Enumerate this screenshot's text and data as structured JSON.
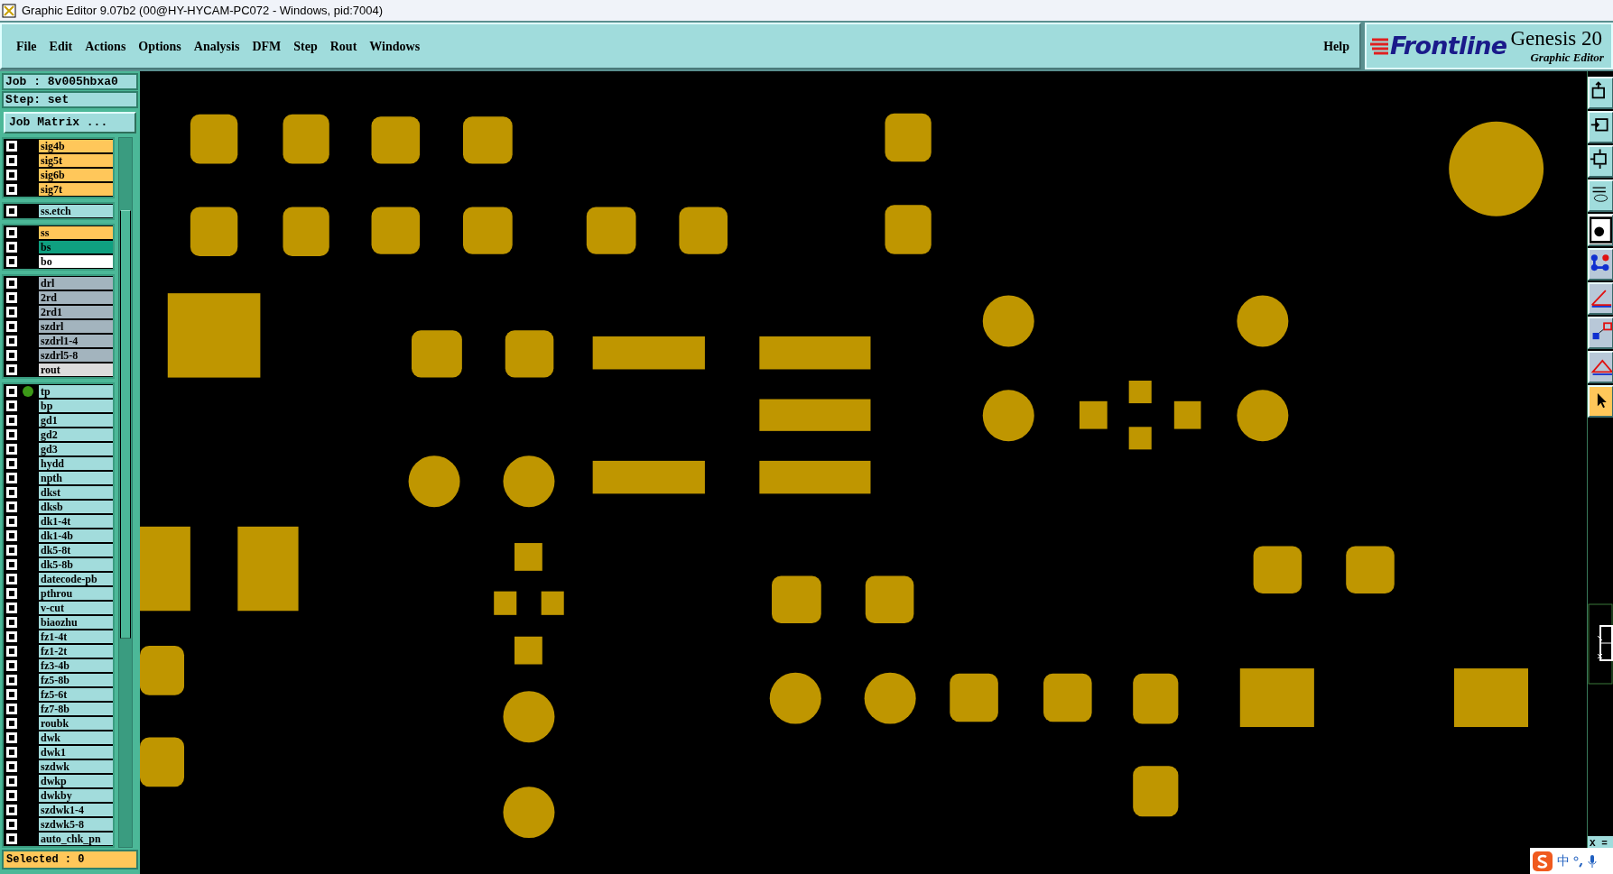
{
  "window": {
    "title": "Graphic Editor 9.07b2 (00@HY-HYCAM-PC072 - Windows, pid:7004)"
  },
  "menu": {
    "items": [
      "File",
      "Edit",
      "Actions",
      "Options",
      "Analysis",
      "DFM",
      "Step",
      "Rout",
      "Windows"
    ],
    "help": "Help"
  },
  "logo": {
    "brand": "Frontline",
    "product": "Genesis 20",
    "subtitle": "Graphic Editor"
  },
  "job": {
    "job_label": "Job : 8v005hbxa0",
    "step_label": "Step: set",
    "matrix_button": "Job Matrix ..."
  },
  "layer_groups": [
    {
      "layers": [
        {
          "name": "sig4b",
          "color": "#ffc75a",
          "checked": false,
          "displayed": false
        },
        {
          "name": "sig5t",
          "color": "#ffc75a",
          "checked": false,
          "displayed": false
        },
        {
          "name": "sig6b",
          "color": "#ffc75a",
          "checked": false,
          "displayed": false
        },
        {
          "name": "sig7t",
          "color": "#ffc75a",
          "checked": false,
          "displayed": false
        }
      ]
    },
    {
      "layers": [
        {
          "name": "ss.etch",
          "color": "#a2dcdc",
          "checked": false,
          "displayed": false
        }
      ]
    },
    {
      "layers": [
        {
          "name": "ss",
          "color": "#ffc75a",
          "checked": false,
          "displayed": false
        },
        {
          "name": "bs",
          "color": "#0fa080",
          "checked": false,
          "displayed": false
        },
        {
          "name": "bo",
          "color": "#ffffff",
          "checked": false,
          "displayed": false
        }
      ]
    },
    {
      "layers": [
        {
          "name": "drl",
          "color": "#a3b4be",
          "checked": false,
          "displayed": false
        },
        {
          "name": "2rd",
          "color": "#a3b4be",
          "checked": false,
          "displayed": false
        },
        {
          "name": "2rd1",
          "color": "#a3b4be",
          "checked": false,
          "displayed": false
        },
        {
          "name": "szdrl",
          "color": "#a3b4be",
          "checked": false,
          "displayed": false
        },
        {
          "name": "szdrl1-4",
          "color": "#a3b4be",
          "checked": false,
          "displayed": false
        },
        {
          "name": "szdrl5-8",
          "color": "#a3b4be",
          "checked": false,
          "displayed": false
        },
        {
          "name": "rout",
          "color": "#dcdcdc",
          "checked": false,
          "displayed": false
        }
      ]
    },
    {
      "layers": [
        {
          "name": "tp",
          "color": "#a2dcdc",
          "checked": false,
          "displayed": true
        },
        {
          "name": "bp",
          "color": "#a2dcdc",
          "checked": false,
          "displayed": false
        },
        {
          "name": "gd1",
          "color": "#a2dcdc",
          "checked": false,
          "displayed": false
        },
        {
          "name": "gd2",
          "color": "#a2dcdc",
          "checked": false,
          "displayed": false
        },
        {
          "name": "gd3",
          "color": "#a2dcdc",
          "checked": false,
          "displayed": false
        },
        {
          "name": "hydd",
          "color": "#a2dcdc",
          "checked": false,
          "displayed": false
        },
        {
          "name": "npth",
          "color": "#a2dcdc",
          "checked": false,
          "displayed": false
        },
        {
          "name": "dkst",
          "color": "#a2dcdc",
          "checked": false,
          "displayed": false
        },
        {
          "name": "dksb",
          "color": "#a2dcdc",
          "checked": false,
          "displayed": false
        },
        {
          "name": "dk1-4t",
          "color": "#a2dcdc",
          "checked": false,
          "displayed": false
        },
        {
          "name": "dk1-4b",
          "color": "#a2dcdc",
          "checked": false,
          "displayed": false
        },
        {
          "name": "dk5-8t",
          "color": "#a2dcdc",
          "checked": false,
          "displayed": false
        },
        {
          "name": "dk5-8b",
          "color": "#a2dcdc",
          "checked": false,
          "displayed": false
        },
        {
          "name": "datecode-pb",
          "color": "#a2dcdc",
          "checked": false,
          "displayed": false
        },
        {
          "name": "pthrou",
          "color": "#a2dcdc",
          "checked": false,
          "displayed": false
        },
        {
          "name": "v-cut",
          "color": "#a2dcdc",
          "checked": false,
          "displayed": false
        },
        {
          "name": "biaozhu",
          "color": "#a2dcdc",
          "checked": false,
          "displayed": false
        },
        {
          "name": "fz1-4t",
          "color": "#a2dcdc",
          "checked": false,
          "displayed": false
        },
        {
          "name": "fz1-2t",
          "color": "#a2dcdc",
          "checked": false,
          "displayed": false
        },
        {
          "name": "fz3-4b",
          "color": "#a2dcdc",
          "checked": false,
          "displayed": false
        },
        {
          "name": "fz5-8b",
          "color": "#a2dcdc",
          "checked": false,
          "displayed": false
        },
        {
          "name": "fz5-6t",
          "color": "#a2dcdc",
          "checked": false,
          "displayed": false
        },
        {
          "name": "fz7-8b",
          "color": "#a2dcdc",
          "checked": false,
          "displayed": false
        },
        {
          "name": "roubk",
          "color": "#a2dcdc",
          "checked": false,
          "displayed": false
        },
        {
          "name": "dwk",
          "color": "#a2dcdc",
          "checked": false,
          "displayed": false
        },
        {
          "name": "dwk1",
          "color": "#a2dcdc",
          "checked": false,
          "displayed": false
        },
        {
          "name": "szdwk",
          "color": "#a2dcdc",
          "checked": false,
          "displayed": false
        },
        {
          "name": "dwkp",
          "color": "#a2dcdc",
          "checked": false,
          "displayed": false
        },
        {
          "name": "dwkby",
          "color": "#a2dcdc",
          "checked": false,
          "displayed": false
        },
        {
          "name": "szdwk1-4",
          "color": "#a2dcdc",
          "checked": false,
          "displayed": false
        },
        {
          "name": "szdwk5-8",
          "color": "#a2dcdc",
          "checked": false,
          "displayed": false
        },
        {
          "name": "auto_chk_pn",
          "color": "#a2dcdc",
          "checked": false,
          "displayed": false
        }
      ]
    }
  ],
  "status": {
    "selected": "Selected : 0"
  },
  "coordinates": {
    "label": "X ="
  },
  "ime": {
    "mode": "中"
  }
}
